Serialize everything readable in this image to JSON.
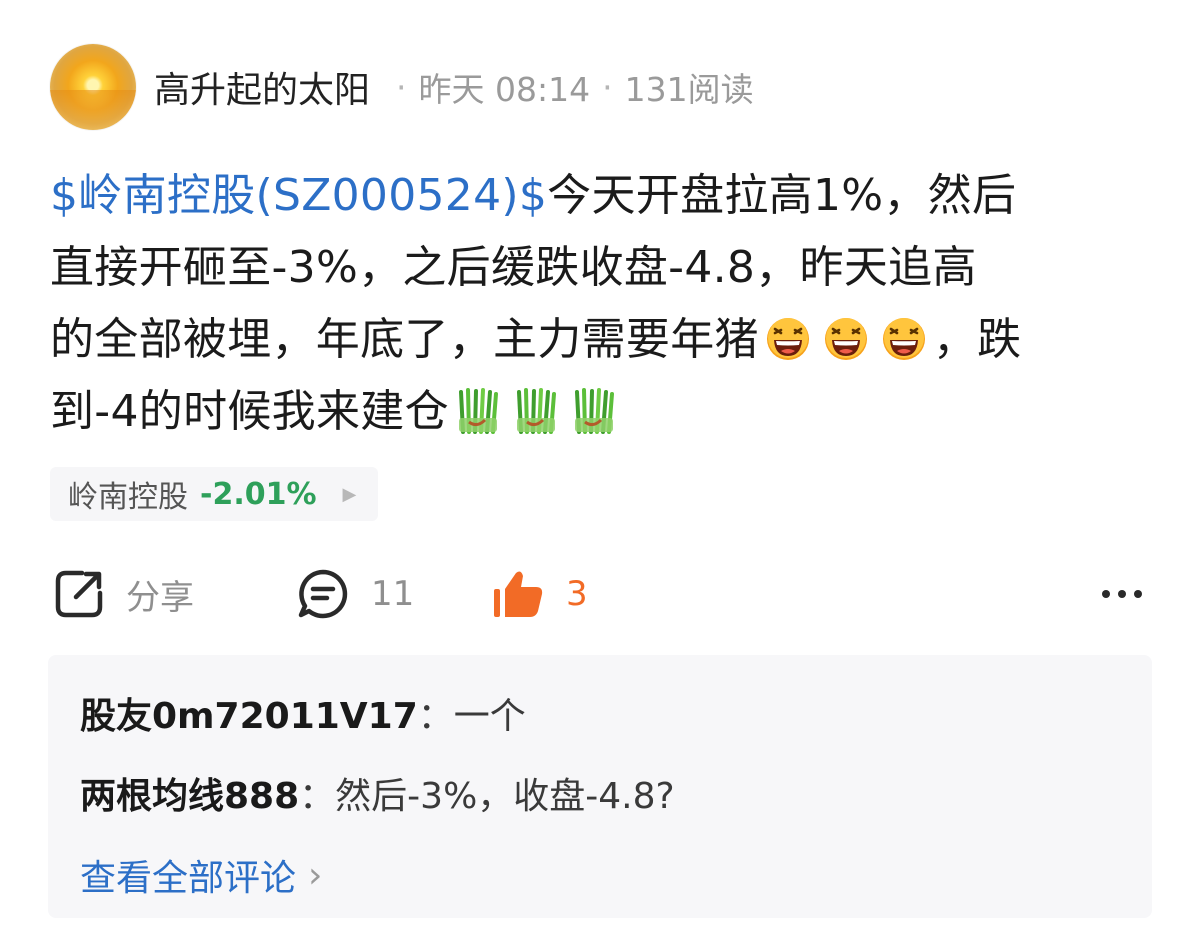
{
  "post": {
    "author": "高升起的太阳",
    "time": "昨天 08:14",
    "reads": "131阅读",
    "separator": "·",
    "content": {
      "stock_link": "$岭南控股(SZ000524)$",
      "line1_rest": "今天开盘拉高1%，然后",
      "line2": "直接开砸至-3%，之后缓跌收盘-4.8，昨天追高",
      "line3_text": "的全部被埋，年底了，主力需要年猪",
      "line3_end": "，跌",
      "line4_text": "到-4的时候我来建仓",
      "laugh_emoji": "laughing-face-emoji",
      "leek_emoji": "leek-emoji"
    },
    "stock_tag": {
      "name": "岭南控股",
      "change": "-2.01%",
      "change_color": "#2ea05a",
      "arrow": "▶"
    }
  },
  "actions": {
    "share_label": "分享",
    "comment_count": "11",
    "like_count": "3",
    "like_color": "#f26b26",
    "more_icon": "more-dots-icon"
  },
  "comments": [
    {
      "user": "股友0m72011V17",
      "sep": "：",
      "text": "一个"
    },
    {
      "user": "两根均线888",
      "sep": "：",
      "text": "然后-3%，收盘-4.8?"
    }
  ],
  "view_all": {
    "label": "查看全部评论",
    "chevron": "›"
  }
}
